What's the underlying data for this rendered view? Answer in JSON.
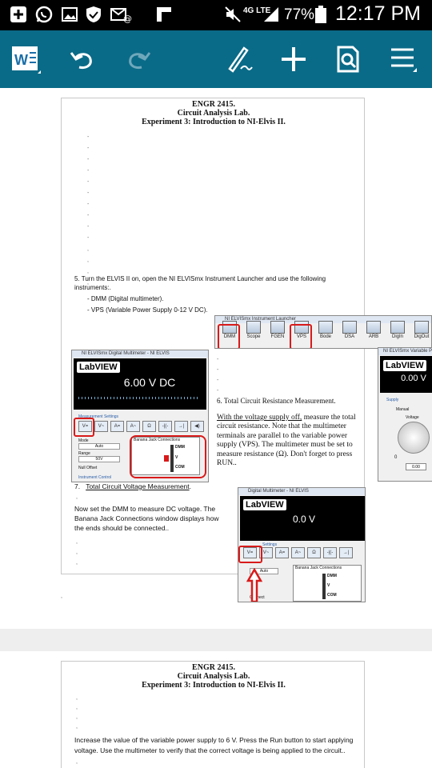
{
  "status_bar": {
    "battery_pct": "77%",
    "time": "12:17 PM",
    "network_label": "4G LTE"
  },
  "page1": {
    "header": {
      "course": "ENGR 2415.",
      "lab": "Circuit Analysis Lab.",
      "experiment": "Experiment 3: Introduction to NI-Elvis II."
    },
    "step5": {
      "intro": "5.   Turn the ELVIS II on, open the  NI ELVISmx Instrument Launcher and use the following instruments:.",
      "item1": "-   DMM (Digital multimeter).",
      "item2": "-   VPS (Variable Power Supply 0-12 V DC)."
    },
    "launcher": {
      "title": "NI ELVISmx Instrument Launcher",
      "tools": [
        "DMM",
        "Scope",
        "FGEN",
        "VPS",
        "Bode",
        "DSA",
        "ARB",
        "DigIn",
        "DigOut"
      ]
    },
    "dmm_window": {
      "title": "NI ELVISmx Digital Multimeter - NI ELVIS",
      "logo": "LabVIEW",
      "reading": "6.00 V DC",
      "measurement_settings": "Measurement Settings",
      "mode_label": "Mode",
      "mode_value": "Auto",
      "range_label": "Range",
      "range_value": "50V",
      "null_offset": "Null Offset",
      "instrument_control": "Instrument Control",
      "banana_title": "Banana Jack Connections",
      "jacks": [
        "DMM",
        "V",
        "COM"
      ],
      "func_buttons": [
        "V=",
        "V~",
        "A=",
        "A~",
        "Ω",
        "-|(-",
        "→|",
        "◀)"
      ]
    },
    "vps_window": {
      "title": "NI ELVISmx Variable Power Supplies",
      "logo": "LabVIEW",
      "reading": "0.00 V",
      "supply_label": "Supply",
      "manual_label": "Manual",
      "voltage_label": "Voltage",
      "dial_min": "0",
      "value_box": "0.00"
    },
    "step6": {
      "heading": "6.      Total Circuit Resistance Measurement.",
      "underlined": "With the voltage supply off,",
      "text": " measure the total circuit resistance.  Note that the multimeter terminals are parallel to the variable power supply (VPS). The multimeter must be set to measure resistance (Ω).  Don't forget to press RUN.."
    },
    "step7": {
      "heading_num": "7.",
      "heading_text": "Total Circuit Voltage Measurement",
      "heading_end": ".",
      "body": "Now set the DMM to measure DC voltage.  The Banana Jack Connections window displays how the ends should be connected.."
    },
    "dmm_small": {
      "title": "Digital Multimeter - NI ELVIS",
      "logo": "LabVIEW",
      "reading": "0.0 V",
      "settings": "Settings",
      "mode_value": "Auto",
      "banana_title": "Banana Jack Connections",
      "jacks": [
        "DMM",
        "V",
        "COM"
      ],
      "connect_label": "Connect"
    }
  },
  "page2": {
    "header": {
      "course": "ENGR 2415.",
      "lab": "Circuit Analysis Lab.",
      "experiment": "Experiment 3: Introduction to NI-Elvis II."
    },
    "body": "Increase the value of the variable power supply to 6 V. Press the Run button to start applying voltage. Use the multimeter to verify that the correct voltage is being applied to the circuit.."
  },
  "colors": {
    "app_bar": "#0a6b88",
    "status_bar": "#000000",
    "highlight_red": "#d91a1a",
    "labview_screen": "#000000"
  }
}
